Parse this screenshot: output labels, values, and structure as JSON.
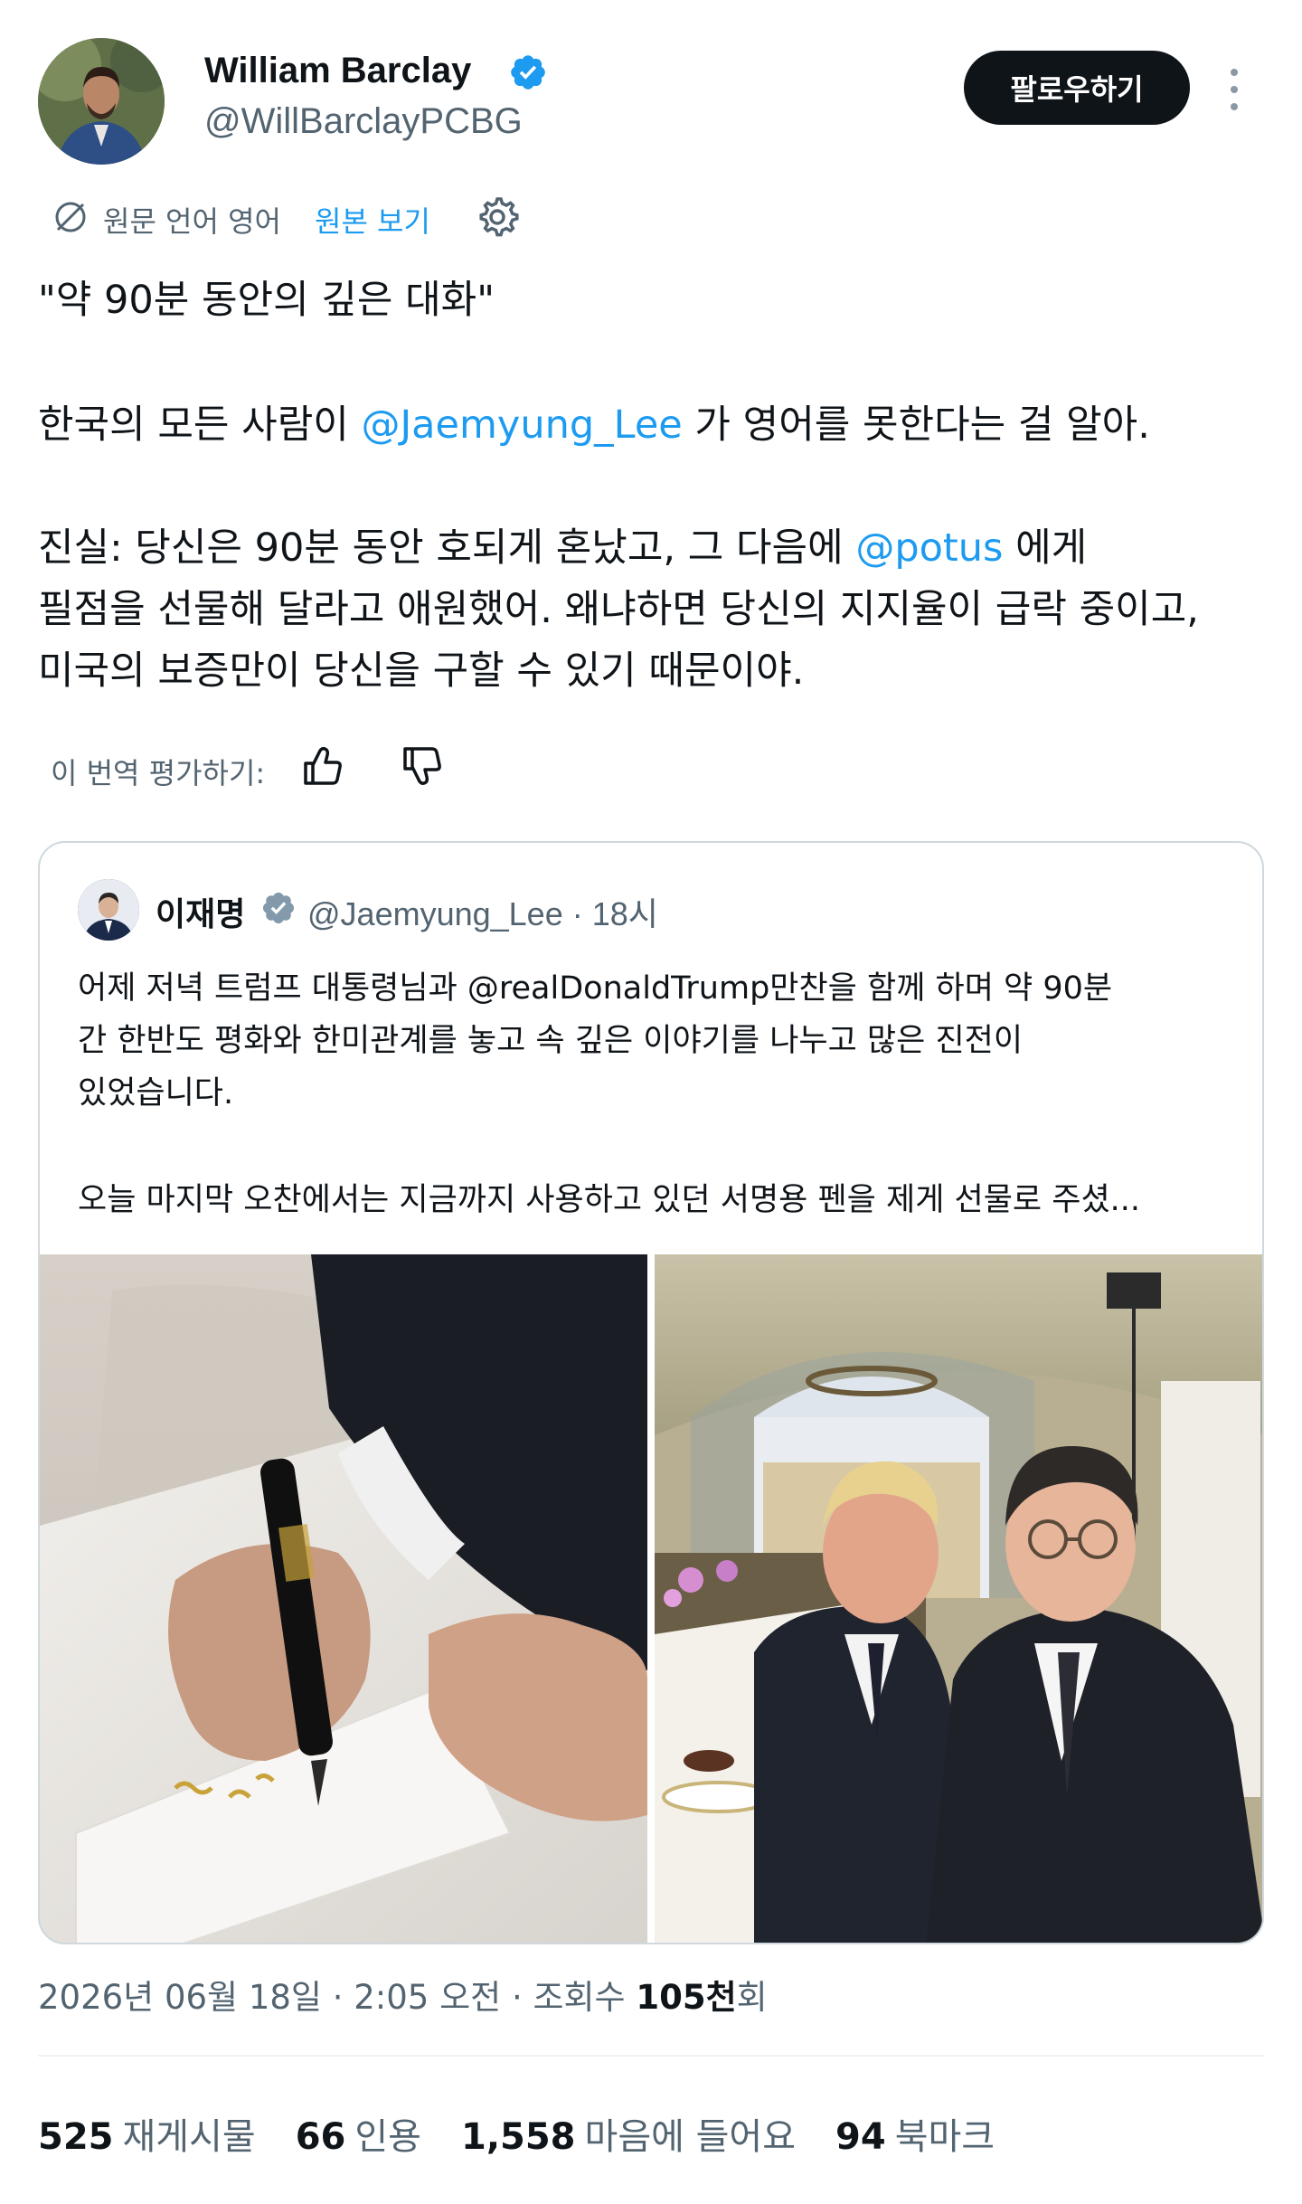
{
  "author": {
    "name": "William Barclay",
    "handle": "@WillBarclayPCBG"
  },
  "follow_label": "팔로우하기",
  "translation": {
    "source_language": "원문 언어 영어",
    "show_original": "원본 보기"
  },
  "tweet": {
    "line1": "\"약 90분 동안의 깊은 대화\"",
    "line2_before": "한국의 모든 사람이 ",
    "line2_mention": "@Jaemyung_Lee",
    "line2_after": " 가 영어를 못한다는 걸 알아.",
    "line3_before": "진실: 당신은 90분 동안 호되게 혼났고, 그 다음에 ",
    "line3_mention": "@potus",
    "line3_after": " 에게",
    "line4": "필점을 선물해 달라고 애원했어. 왜냐하면 당신의 지지율이 급락 중이고,",
    "line5": "미국의 보증만이 당신을 구할 수 있기 때문이야."
  },
  "rating": {
    "label": "이 번역 평가하기:"
  },
  "quoted": {
    "name": "이재명",
    "meta": "@Jaemyung_Lee · 18시",
    "line1": "어제 저녁 트럼프 대통령님과 @realDonaldTrump만찬을 함께 하며 약 90분",
    "line2": "간 한반도 평화와 한미관계를 놓고 속 깊은 이야기를 나누고 많은 진전이",
    "line3": "있었습니다.",
    "line4": "오늘 마지막 오찬에서는 지금까지 사용하고 있던 서명용 펜을 제게 선물로 주셨..."
  },
  "timestamp": {
    "date": "2026년 06월 18일 · 2:05 오전 · 조회수 ",
    "views": "105천",
    "views_suffix": "회"
  },
  "stats": [
    {
      "count": "525",
      "label": "재게시물"
    },
    {
      "count": "66",
      "label": "인용"
    },
    {
      "count": "1,558",
      "label": "마음에 들어요"
    },
    {
      "count": "94",
      "label": "북마크"
    }
  ],
  "colors": {
    "link": "#1d9bf0",
    "muted": "#536471",
    "text": "#0f1419",
    "verified": "#1d9bf0",
    "q_verified": "#829aab"
  }
}
